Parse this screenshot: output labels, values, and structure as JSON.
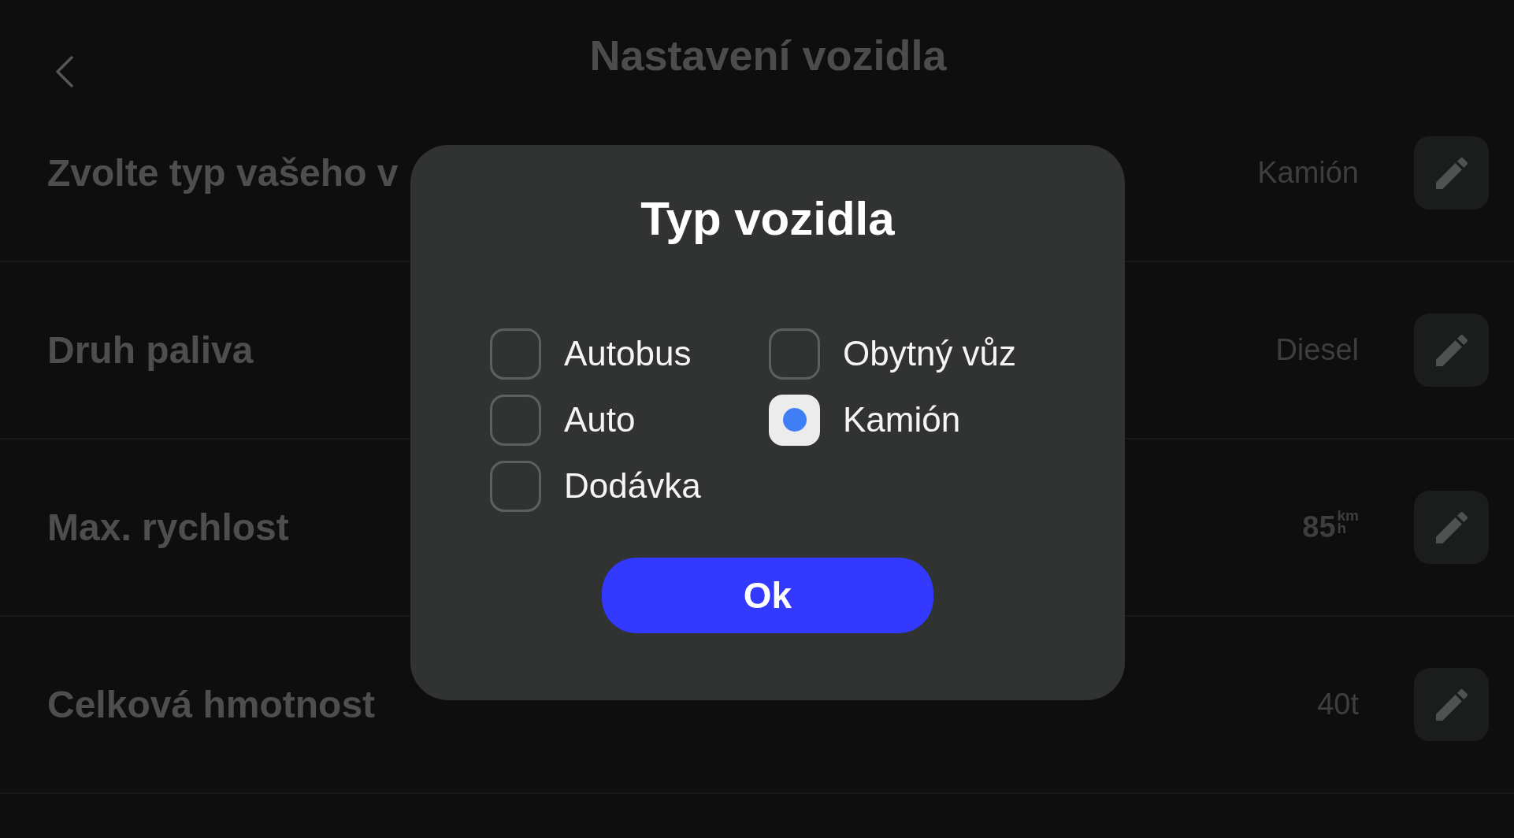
{
  "header": {
    "title": "Nastavení vozidla"
  },
  "settings": [
    {
      "label": "Zvolte typ vašeho v",
      "value": "Kamión"
    },
    {
      "label": "Druh paliva",
      "value": "Diesel"
    },
    {
      "label": "Max. rychlost",
      "value": "85",
      "unit": {
        "top": "km",
        "bottom": "h"
      }
    },
    {
      "label": "Celková hmotnost",
      "value": "40t"
    }
  ],
  "dialog": {
    "title": "Typ vozidla",
    "options": [
      {
        "label": "Autobus",
        "selected": false
      },
      {
        "label": "Auto",
        "selected": false
      },
      {
        "label": "Dodávka",
        "selected": false
      },
      {
        "label": "Obytný vůz",
        "selected": false
      },
      {
        "label": "Kamión",
        "selected": true
      }
    ],
    "button": "Ok"
  }
}
